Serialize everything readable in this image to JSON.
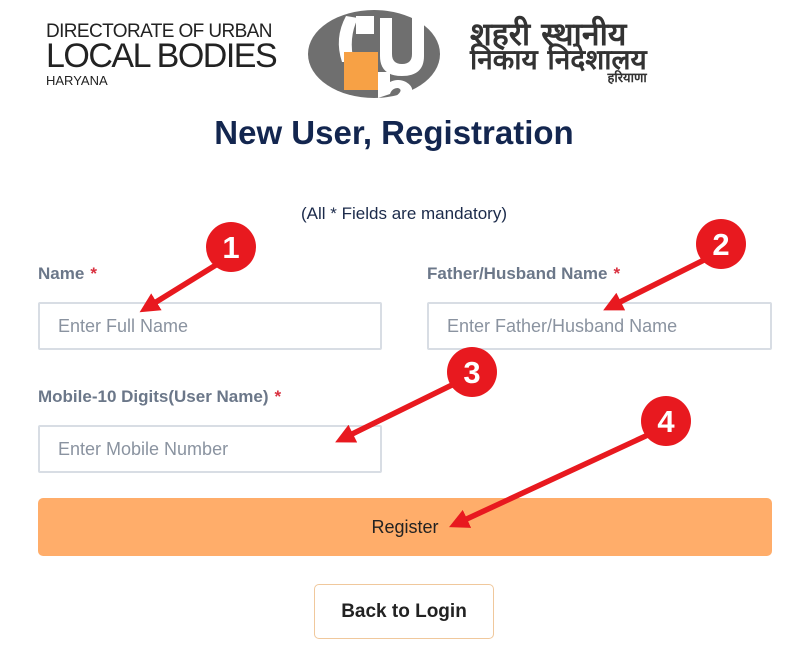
{
  "header": {
    "org_en_line1": "DIRECTORATE OF URBAN",
    "org_en_line2": "LOCAL BODIES",
    "org_en_line3": "HARYANA",
    "org_hi_line1": "शहरी स्थानीय",
    "org_hi_line2": "निकाय निदेशालय",
    "org_hi_line3": "हरियाणा"
  },
  "page": {
    "title": "New User, Registration",
    "mandatory_note": "(All * Fields are mandatory)"
  },
  "form": {
    "name": {
      "label": "Name",
      "required_mark": "*",
      "placeholder": "Enter Full Name",
      "value": ""
    },
    "father": {
      "label": "Father/Husband Name",
      "required_mark": "*",
      "placeholder": "Enter Father/Husband Name",
      "value": ""
    },
    "mobile": {
      "label": "Mobile-10 Digits(User Name)",
      "required_mark": "*",
      "placeholder": "Enter Mobile Number",
      "value": ""
    },
    "register_label": "Register",
    "back_label": "Back to Login"
  },
  "annotations": {
    "color": "#e8191f",
    "numbers": [
      "1",
      "2",
      "3",
      "4"
    ]
  },
  "colors": {
    "title": "#13264f",
    "required": "#d9303f",
    "register_button": "#ffad6a",
    "emblem_orange": "#f7a145",
    "emblem_gray": "#6f6f6f"
  }
}
